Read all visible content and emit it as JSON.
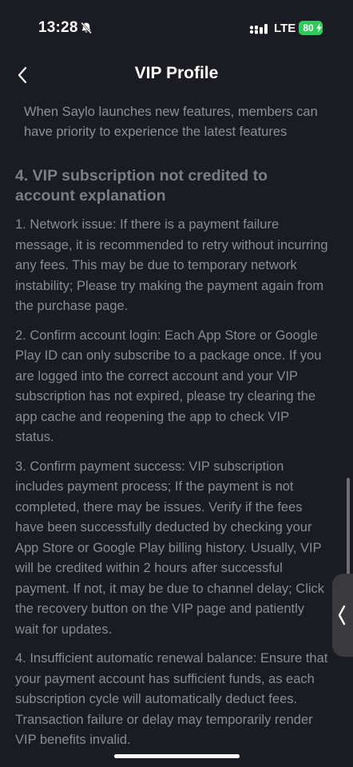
{
  "status_bar": {
    "time": "13:28",
    "carrier": "LTE",
    "battery": "80"
  },
  "nav": {
    "title": "VIP Profile"
  },
  "content": {
    "intro": "When Saylo launches new features, members can have priority to experience the latest features",
    "section_heading": "4. VIP subscription not credited to account explanation",
    "paragraphs": [
      "1. Network issue: If there is a payment failure message, it is recommended to retry without incurring any fees. This may be due to temporary network instability; Please try making the payment again from the purchase page.",
      "2. Confirm account login: Each App Store or Google Play ID can only subscribe to a package once. If you are logged into the correct account and your VIP subscription has not expired, please try clearing the app cache and reopening the app to check VIP status.",
      "3. Confirm payment success: VIP subscription includes payment process; If the payment is not completed, there may be issues. Verify if the fees have been successfully deducted by checking your App Store or Google Play billing history. Usually, VIP will be credited within 2 hours after successful payment. If not, it may be due to channel delay; Click the recovery button on the VIP page and patiently wait for updates.",
      "4. Insufficient automatic renewal balance: Ensure that your payment account has sufficient funds, as each subscription cycle will automatically deduct fees. Transaction failure or delay may temporarily render VIP benefits invalid."
    ]
  },
  "icons": {
    "status": [
      "bell-slash-icon",
      "signal-bars-icon",
      "bolt-icon"
    ],
    "nav": [
      "chevron-left-icon"
    ],
    "side": [
      "chevron-left-icon"
    ]
  },
  "colors": {
    "background": "#1b1b23",
    "battery": "#34c759",
    "text_muted": "#8a8a93"
  }
}
